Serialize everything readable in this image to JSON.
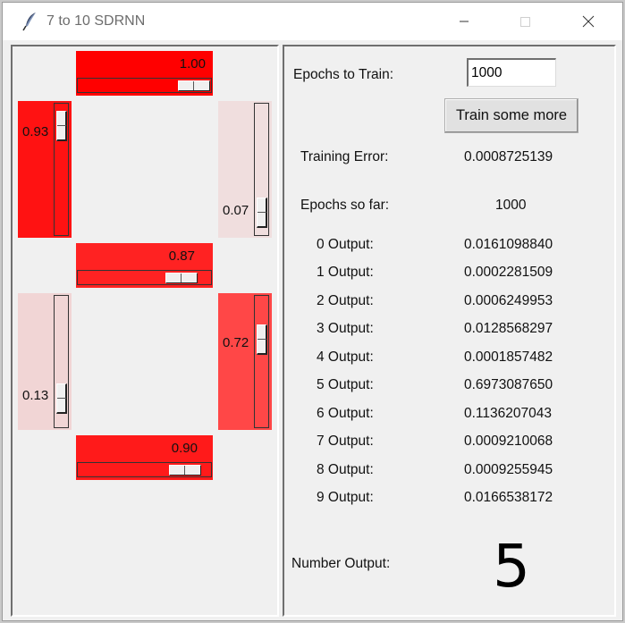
{
  "window": {
    "title": "7 to 10 SDRNN",
    "icon": "feather-icon",
    "controls": [
      "minimize-icon",
      "maximize-icon",
      "close-icon"
    ]
  },
  "segments": {
    "top": {
      "value": 0.995,
      "label": "1.00",
      "color": "#ff0000"
    },
    "top_left": {
      "value": 0.93,
      "label": "0.93",
      "color": "#ff1212"
    },
    "top_right": {
      "value": 0.07,
      "label": "0.07",
      "color": "#f0dede"
    },
    "middle": {
      "value": 0.87,
      "label": "0.87",
      "color": "#ff2222"
    },
    "bottom_left": {
      "value": 0.13,
      "label": "0.13",
      "color": "#f1d5d5"
    },
    "bottom_right": {
      "value": 0.72,
      "label": "0.72",
      "color": "#ff4747"
    },
    "bottom": {
      "value": 0.9,
      "label": "0.90",
      "color": "#ff1a1a"
    }
  },
  "controls": {
    "epochs_label": "Epochs to Train:",
    "epochs_value": "1000",
    "train_button": "Train some more"
  },
  "stats": {
    "training_error_label": "Training Error:",
    "training_error_value": "0.0008725139",
    "epochs_so_far_label": "Epochs so far:",
    "epochs_so_far_value": "1000"
  },
  "outputs": [
    {
      "label": "0 Output:",
      "value": "0.0161098840"
    },
    {
      "label": "1 Output:",
      "value": "0.0002281509"
    },
    {
      "label": "2 Output:",
      "value": "0.0006249953"
    },
    {
      "label": "3 Output:",
      "value": "0.0128568297"
    },
    {
      "label": "4 Output:",
      "value": "0.0001857482"
    },
    {
      "label": "5 Output:",
      "value": "0.6973087650"
    },
    {
      "label": "6 Output:",
      "value": "0.1136207043"
    },
    {
      "label": "7 Output:",
      "value": "0.0009210068"
    },
    {
      "label": "8 Output:",
      "value": "0.0009255945"
    },
    {
      "label": "9 Output:",
      "value": "0.0166538172"
    }
  ],
  "number_output": {
    "label": "Number Output:",
    "value": "5"
  }
}
